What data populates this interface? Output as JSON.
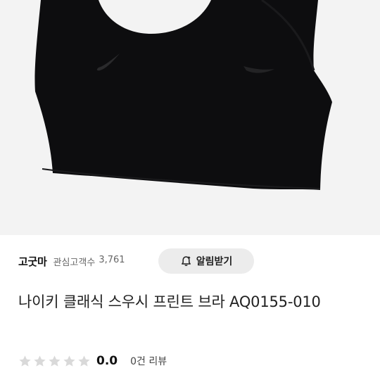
{
  "image": {
    "alt": "",
    "background": "#f3f3f3",
    "product_color": "#0d0d0f"
  },
  "seller": {
    "name": "고굿마",
    "followers_label": "관심고객수",
    "followers_count": "3,761",
    "follow_button_label": "알림받기"
  },
  "product": {
    "title": "나이키 클래식 스우시 프린트 브라 AQ0155-010"
  },
  "rating": {
    "value": "0.0",
    "stars_filled": 0,
    "stars_total": 5,
    "review_count": "0건",
    "review_label": "리뷰"
  },
  "colors": {
    "star_empty": "#d9d9d9",
    "button_bg": "#ececec"
  }
}
